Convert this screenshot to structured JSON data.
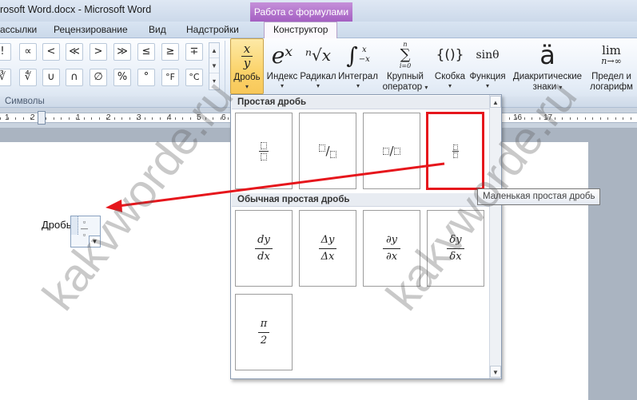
{
  "window": {
    "title": "rosoft Word.docx  -  Microsoft Word",
    "context_group": "Работа с формулами"
  },
  "tabs": [
    "ассылки",
    "Рецензирование",
    "Вид",
    "Надстройки",
    "Конструктор"
  ],
  "symbols": {
    "row1": [
      "!",
      "∝",
      "<",
      "≪",
      ">",
      "≫",
      "≤",
      "≥",
      "∓"
    ],
    "row2": [
      "∛",
      "∜",
      "∪",
      "∩",
      "∅",
      "%",
      "°",
      "°F",
      "°C"
    ],
    "group_label": "Символы"
  },
  "ribbon": {
    "fraction": {
      "num": "x",
      "den": "y",
      "label": "Дробь"
    },
    "index": {
      "glyph": "eˣ",
      "label": "Индекс"
    },
    "radical": {
      "glyph": "ⁿ√x",
      "label": "Радикал"
    },
    "integral": {
      "glyph": "∫",
      "upper": "x",
      "lower": "−x",
      "label": "Интеграл"
    },
    "large_operator": {
      "glyph": "∑",
      "upper": "n",
      "lower": "i=0",
      "label1": "Крупный",
      "label2": "оператор"
    },
    "bracket": {
      "glyph": "{()}",
      "label": "Скобка"
    },
    "function": {
      "glyph": "sinθ",
      "label": "Функция"
    },
    "accent": {
      "glyph": "ä",
      "label1": "Диакритические",
      "label2": "знаки"
    },
    "limit": {
      "glyph": "lim",
      "sub": "n→∞",
      "label1": "Предел и",
      "label2": "логарифм"
    }
  },
  "ruler": {
    "numbers": [
      "1",
      "2",
      "1",
      "2",
      "3",
      "4",
      "5",
      "6",
      "16",
      "17"
    ]
  },
  "document": {
    "text": "Дробь"
  },
  "gallery": {
    "section1": "Простая дробь",
    "section2": "Обычная простая дробь",
    "common": [
      {
        "num": "dy",
        "den": "dx"
      },
      {
        "num": "Δy",
        "den": "Δx"
      },
      {
        "num": "∂y",
        "den": "∂x"
      },
      {
        "num": "δy",
        "den": "δx"
      },
      {
        "num": "π",
        "den": "2"
      }
    ]
  },
  "tooltip": "Маленькая простая дробь",
  "watermark": "kakvworde.ru",
  "colors": {
    "highlight_red": "#e6161c",
    "context_purple": "#a45fc2",
    "selected_gold": "#fbd36a"
  }
}
